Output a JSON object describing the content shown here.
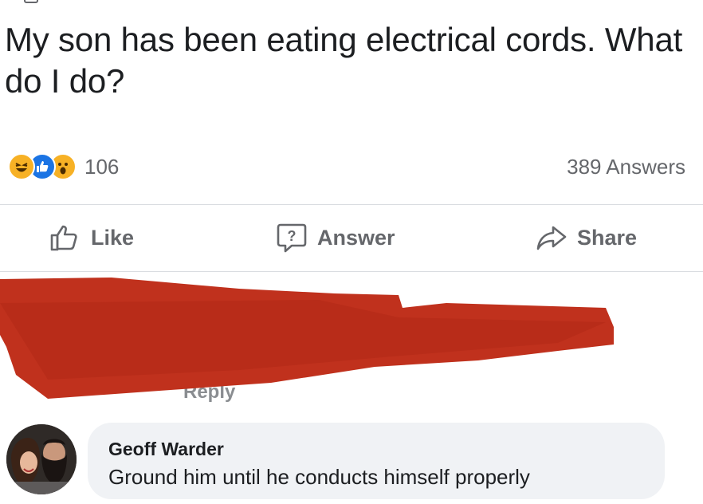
{
  "post": {
    "question": "My son has been eating electrical cords. What do I do?",
    "reaction_count": "106",
    "reaction_icons": [
      "haha-icon",
      "like-icon",
      "wow-icon"
    ],
    "answers_count": "389 Answers"
  },
  "actions": {
    "like_label": "Like",
    "answer_label": "Answer",
    "share_label": "Share"
  },
  "redacted_comment": {
    "reply_label": "Reply"
  },
  "comment": {
    "author": "Geoff Warder",
    "text": "Ground him until he conducts himself properly"
  },
  "colors": {
    "redaction": "#c0311d",
    "like_blue": "#1b74e4",
    "reaction_yellow": "#f7b125",
    "muted_text": "#65676b",
    "bubble_bg": "#f0f2f5"
  }
}
